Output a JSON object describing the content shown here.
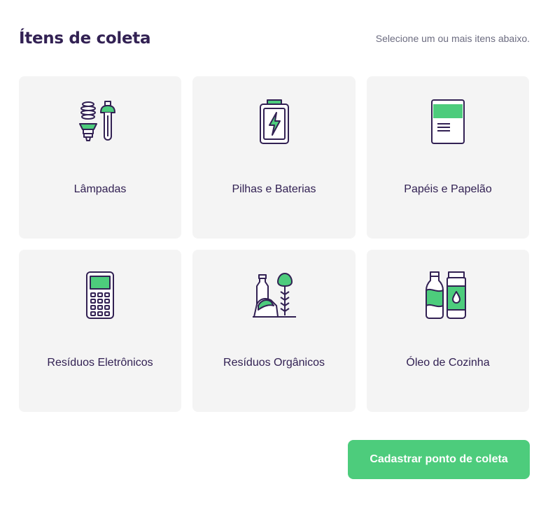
{
  "header": {
    "title": "Ítens de coleta",
    "subtitle": "Selecione um ou mais itens abaixo."
  },
  "items": [
    {
      "label": "Lâmpadas",
      "icon": "lamps-icon"
    },
    {
      "label": "Pilhas e Baterias",
      "icon": "battery-icon"
    },
    {
      "label": "Papéis e Papelão",
      "icon": "paper-icon"
    },
    {
      "label": "Resíduos Eletrônicos",
      "icon": "electronics-icon"
    },
    {
      "label": "Resíduos Orgânicos",
      "icon": "organic-waste-icon"
    },
    {
      "label": "Óleo de Cozinha",
      "icon": "cooking-oil-icon"
    }
  ],
  "actions": {
    "submit_label": "Cadastrar ponto de coleta"
  },
  "colors": {
    "primary": "#4dcc7c",
    "title": "#322153",
    "text": "#6c6c80",
    "card": "#f4f4f4"
  }
}
